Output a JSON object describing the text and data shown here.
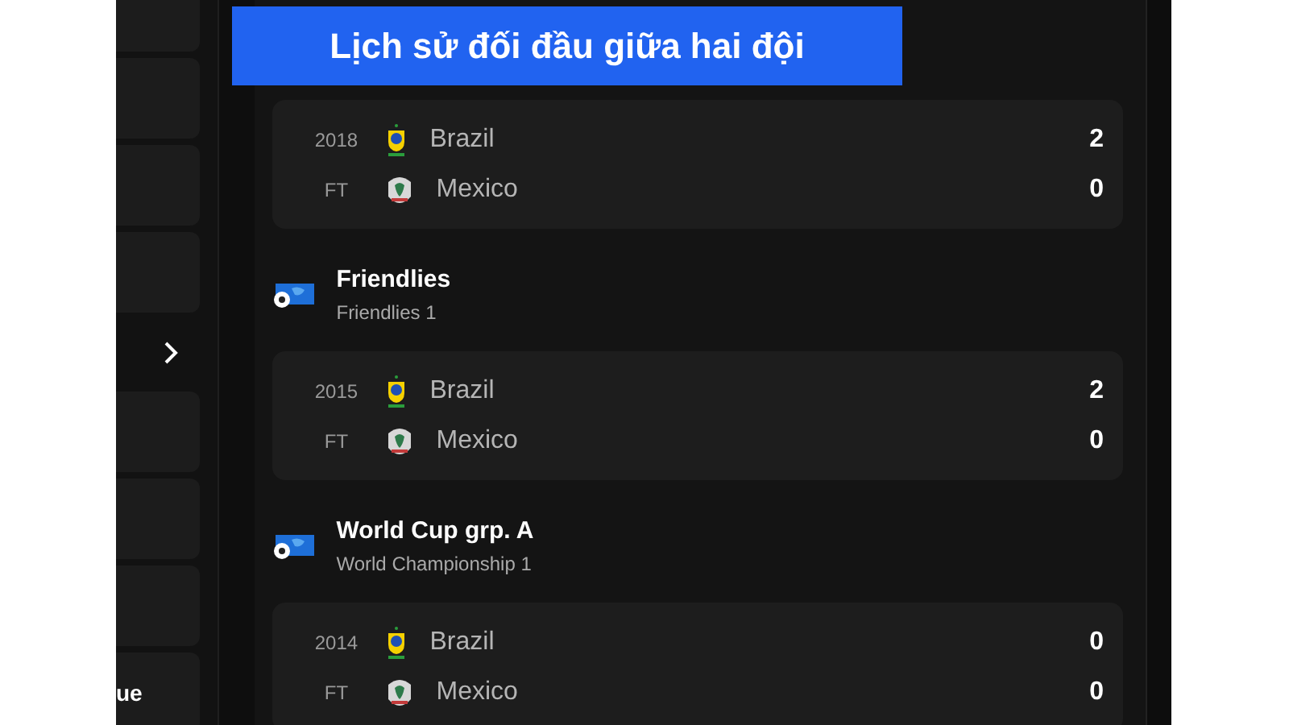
{
  "banner": {
    "title": "Lịch sử đối đầu giữa hai đội"
  },
  "sidebar": {
    "items": [
      {
        "kind": "card"
      },
      {
        "kind": "card"
      },
      {
        "kind": "card"
      },
      {
        "kind": "card"
      },
      {
        "kind": "chevron"
      },
      {
        "kind": "card"
      },
      {
        "kind": "card"
      },
      {
        "kind": "card"
      },
      {
        "kind": "card",
        "label": "ue"
      }
    ]
  },
  "sections": [
    {
      "match": {
        "date": "2018",
        "status": "FT",
        "teams": [
          {
            "name": "Brazil",
            "score": "2",
            "kind": "brazil"
          },
          {
            "name": "Mexico",
            "score": "0",
            "kind": "mexico"
          }
        ]
      }
    },
    {
      "league": {
        "name": "Friendlies",
        "subtitle": "Friendlies 1"
      },
      "match": {
        "date": "2015",
        "status": "FT",
        "teams": [
          {
            "name": "Brazil",
            "score": "2",
            "kind": "brazil"
          },
          {
            "name": "Mexico",
            "score": "0",
            "kind": "mexico"
          }
        ]
      }
    },
    {
      "league": {
        "name": "World Cup grp. A",
        "subtitle": "World Championship 1"
      },
      "match": {
        "date": "2014",
        "status": "FT",
        "teams": [
          {
            "name": "Brazil",
            "score": "0",
            "kind": "brazil"
          },
          {
            "name": "Mexico",
            "score": "0",
            "kind": "mexico"
          }
        ]
      }
    }
  ]
}
